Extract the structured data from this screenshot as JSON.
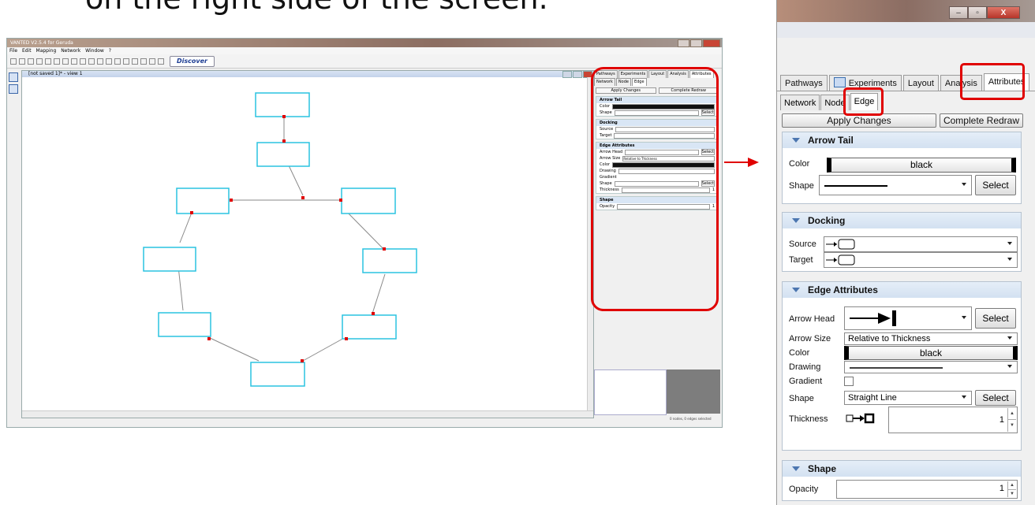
{
  "heading": "on the right side of the screen.",
  "main_window": {
    "title": "VANTED V2.5.4 for Geruda",
    "menu": [
      "File",
      "Edit",
      "Mapping",
      "Network",
      "Window",
      "?"
    ],
    "discover_label": "Discover",
    "view_title": "[not saved 1]* - view 1",
    "side_tabs": [
      "Pathways",
      "Experiments",
      "Layout",
      "Analysis",
      "Attributes"
    ],
    "side_subtabs": [
      "Network",
      "Node",
      "Edge"
    ],
    "side_buttons": [
      "Apply Changes",
      "Complete Redraw"
    ],
    "sections": {
      "arrow_tail": "Arrow Tail",
      "docking": "Docking",
      "edge_attributes": "Edge Attributes",
      "shape": "Shape"
    },
    "rows": {
      "color": "Color",
      "shape": "Shape",
      "black": "black",
      "select": "Select",
      "source": "Source",
      "target": "Target",
      "arrow_head": "Arrow Head",
      "arrow_size": "Arrow Size",
      "arrow_size_value": "Relative to Thickness",
      "drawing": "Drawing",
      "gradient": "Gradient",
      "thickness": "Thickness",
      "opacity": "Opacity",
      "one": "1"
    },
    "status": "0 nodes, 0 edges selected"
  },
  "zoom_panel": {
    "window_controls": [
      "–",
      "▫",
      "X"
    ],
    "tabs": [
      {
        "label": "Pathways",
        "icon": null
      },
      {
        "label": "Experiments",
        "icon": "experiments-icon"
      },
      {
        "label": "Layout",
        "icon": null
      },
      {
        "label": "Analysis",
        "icon": null
      },
      {
        "label": "Attributes",
        "icon": null,
        "active": true
      }
    ],
    "subtabs": [
      {
        "label": "Network"
      },
      {
        "label": "Node"
      },
      {
        "label": "Edge",
        "active": true
      }
    ],
    "buttons": {
      "apply": "Apply Changes",
      "redraw": "Complete Redraw"
    },
    "arrow_tail": {
      "title": "Arrow Tail",
      "color_label": "Color",
      "color_value": "black",
      "shape_label": "Shape",
      "select": "Select"
    },
    "docking": {
      "title": "Docking",
      "source_label": "Source",
      "target_label": "Target"
    },
    "edge_attributes": {
      "title": "Edge Attributes",
      "arrow_head_label": "Arrow Head",
      "arrow_head_select": "Select",
      "arrow_size_label": "Arrow Size",
      "arrow_size_value": "Relative to Thickness",
      "color_label": "Color",
      "color_value": "black",
      "drawing_label": "Drawing",
      "gradient_label": "Gradient",
      "shape_label": "Shape",
      "shape_value": "Straight Line",
      "shape_select": "Select",
      "thickness_label": "Thickness",
      "thickness_value": "1"
    },
    "shape": {
      "title": "Shape",
      "opacity_label": "Opacity",
      "opacity_value": "1"
    }
  },
  "colors": {
    "highlight": "#e00000",
    "node_border": "#2ac3e0",
    "edge_marker": "#e00000"
  }
}
